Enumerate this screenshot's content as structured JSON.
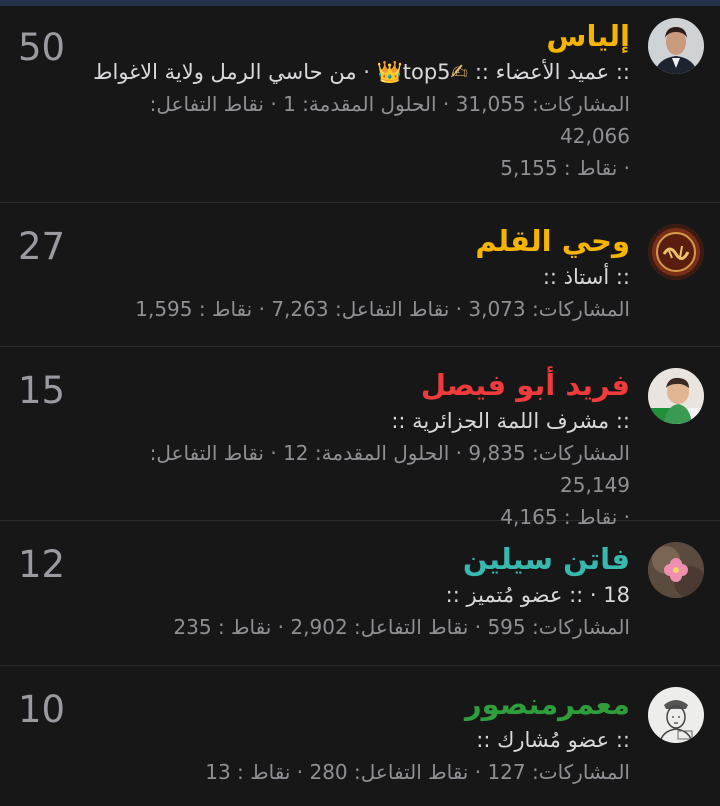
{
  "members": [
    {
      "name": "إلياس",
      "name_color": "#f4b400",
      "title_parts": [
        ":: عميد الأعضاء :: ",
        "✍",
        "top5",
        "👑",
        " · من حاسي الرمل ولاية الاغواط"
      ],
      "stats_line1": "المشاركات: 31,055 · الحلول المقدمة: 1 · نقاط التفاعل: 42,066",
      "stats_line2": "· نقاط : 5,155",
      "score": "50",
      "avatar_icon": "man-portrait-avatar"
    },
    {
      "name": "وحي القلم",
      "name_color": "#f4b400",
      "title": ":: أستاذ ::",
      "stats_line1": "المشاركات: 3,073 · نقاط التفاعل: 7,263 · نقاط : 1,595",
      "score": "27",
      "avatar_icon": "calligraphy-emblem-avatar"
    },
    {
      "name": "فريد أبو فيصل",
      "name_color": "#ef3b3b",
      "title": ":: مشرف اللمة الجزائرية ::",
      "stats_line1": "المشاركات: 9,835 · الحلول المقدمة: 12 · نقاط التفاعل: 25,149",
      "stats_line2": "· نقاط : 4,165",
      "score": "15",
      "avatar_icon": "child-flag-avatar"
    },
    {
      "name": "فاتن سيلين",
      "name_color": "#39b8b0",
      "title": "18 · :: عضو مُتميز ::",
      "stats_line1": "المشاركات: 595 · نقاط التفاعل: 2,902 · نقاط : 235",
      "score": "12",
      "avatar_icon": "pink-flower-avatar"
    },
    {
      "name": "معمرمنصور",
      "name_color": "#2e9e3c",
      "title": ":: عضو مُشارك ::",
      "stats_line1": "المشاركات: 127 · نقاط التفاعل: 280 · نقاط : 13",
      "score": "10",
      "avatar_icon": "sketch-portrait-avatar"
    }
  ]
}
